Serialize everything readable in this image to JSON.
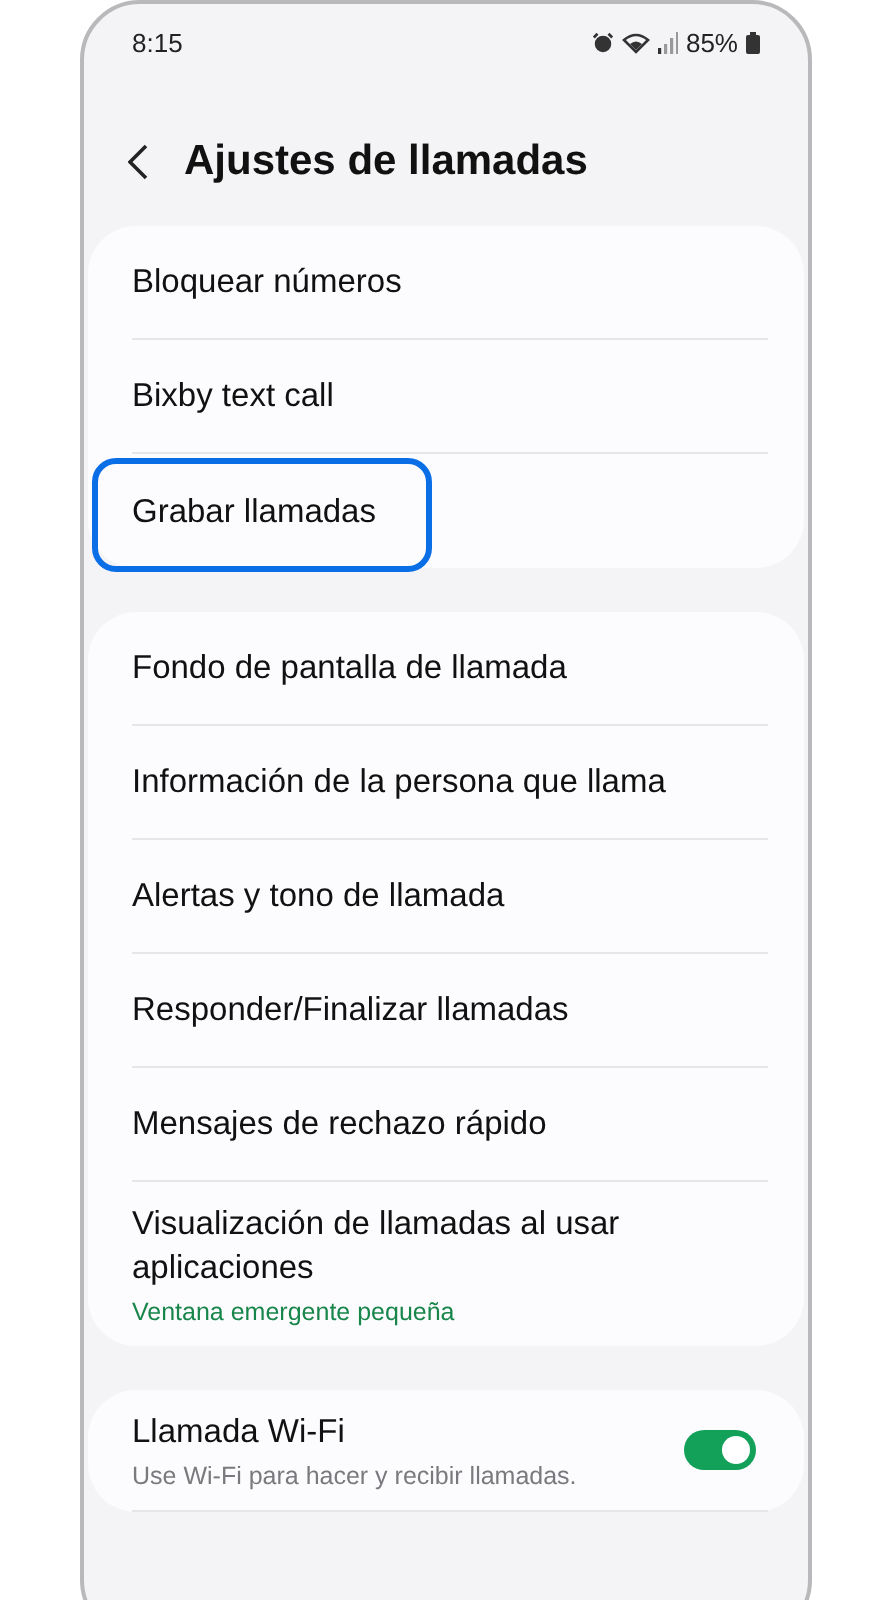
{
  "status_bar": {
    "time": "8:15",
    "battery": "85%"
  },
  "header": {
    "title": "Ajustes de llamadas"
  },
  "groups": [
    {
      "items": [
        {
          "kind": "link",
          "label": "Bloquear números",
          "highlighted": false
        },
        {
          "kind": "link",
          "label": "Bixby text call",
          "highlighted": false
        },
        {
          "kind": "link",
          "label": "Grabar llamadas",
          "highlighted": true
        }
      ]
    },
    {
      "items": [
        {
          "kind": "link",
          "label": "Fondo de pantalla de llamada",
          "highlighted": false
        },
        {
          "kind": "link",
          "label": "Información de la persona que llama",
          "highlighted": false
        },
        {
          "kind": "link",
          "label": "Alertas y tono de llamada",
          "highlighted": false
        },
        {
          "kind": "link",
          "label": "Responder/Finalizar llamadas",
          "highlighted": false
        },
        {
          "kind": "link",
          "label": "Mensajes de rechazo rápido",
          "highlighted": false
        },
        {
          "kind": "link",
          "label": "Visualización de llamadas al usar aplicaciones",
          "subtitle": "Ventana emergente pequeña",
          "highlighted": false
        }
      ]
    },
    {
      "items": [
        {
          "kind": "toggle",
          "label": "Llamada Wi-Fi",
          "description": "Use Wi-Fi para hacer y recibir llamadas.",
          "on": true,
          "highlighted": false
        }
      ]
    }
  ]
}
